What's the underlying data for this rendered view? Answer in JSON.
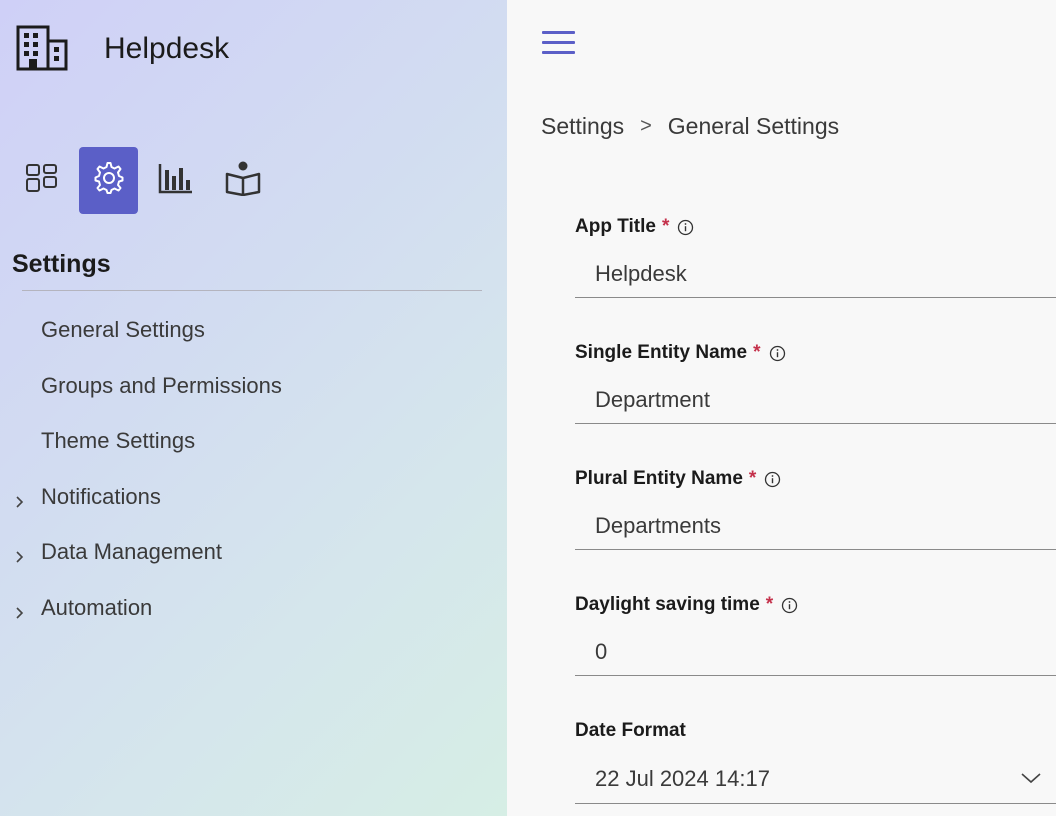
{
  "app": {
    "title": "Helpdesk"
  },
  "nav": {
    "icons": [
      {
        "name": "dashboard-icon",
        "active": false
      },
      {
        "name": "settings-icon",
        "active": true
      },
      {
        "name": "reports-icon",
        "active": false
      },
      {
        "name": "knowledge-icon",
        "active": false
      }
    ]
  },
  "sidebar": {
    "title": "Settings",
    "items": [
      {
        "label": "General Settings",
        "expandable": false
      },
      {
        "label": "Groups and Permissions",
        "expandable": false
      },
      {
        "label": "Theme Settings",
        "expandable": false
      },
      {
        "label": "Notifications",
        "expandable": true
      },
      {
        "label": "Data Management",
        "expandable": true
      },
      {
        "label": "Automation",
        "expandable": true
      }
    ]
  },
  "breadcrumb": {
    "parent": "Settings",
    "separator": ">",
    "current": "General Settings"
  },
  "form": {
    "app_title": {
      "label": "App Title",
      "required_mark": "*",
      "value": "Helpdesk"
    },
    "single_entity_name": {
      "label": "Single Entity Name",
      "required_mark": "*",
      "value": "Department"
    },
    "plural_entity_name": {
      "label": "Plural Entity Name",
      "required_mark": "*",
      "value": "Departments"
    },
    "daylight_saving_time": {
      "label": "Daylight saving time",
      "required_mark": "*",
      "value": "0"
    },
    "date_format": {
      "label": "Date Format",
      "value": "22 Jul 2024 14:17"
    }
  },
  "colors": {
    "accent": "#5b5fc7",
    "required": "#c4314b",
    "sidebar_gradient_start": "#cfd0f7",
    "sidebar_gradient_end": "#d6eee5"
  }
}
